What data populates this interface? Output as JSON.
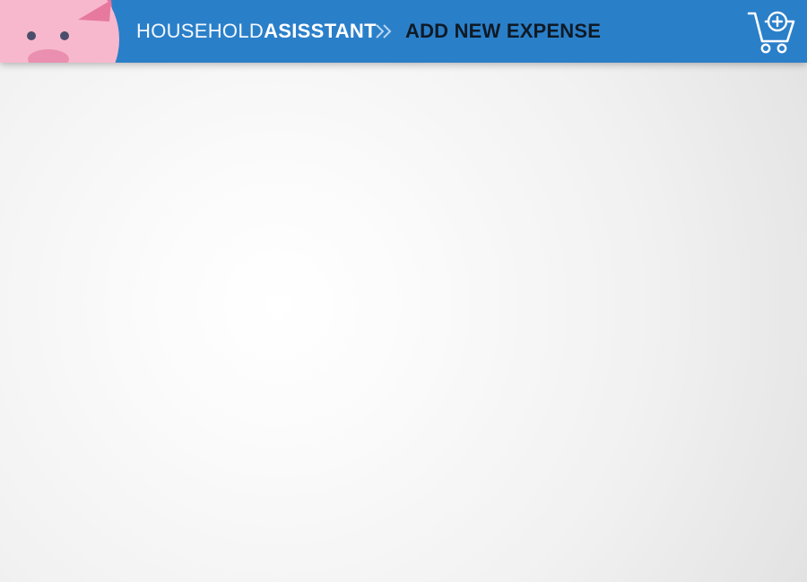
{
  "header": {
    "brand_light": "HOUSEHOLD",
    "brand_bold": "ASISSTANT",
    "page_title": "ADD NEW EXPENSE",
    "separator_icon": "double-chevron-right-icon",
    "logo_icon": "pig-icon",
    "cart_icon": "cart-add-icon"
  },
  "colors": {
    "header_bg": "#2a7fc9",
    "page_title": "#0f1a26",
    "pig_pink": "#f7b8cd",
    "pig_ear": "#e56f9c",
    "pig_snout": "#ea8fb0"
  }
}
